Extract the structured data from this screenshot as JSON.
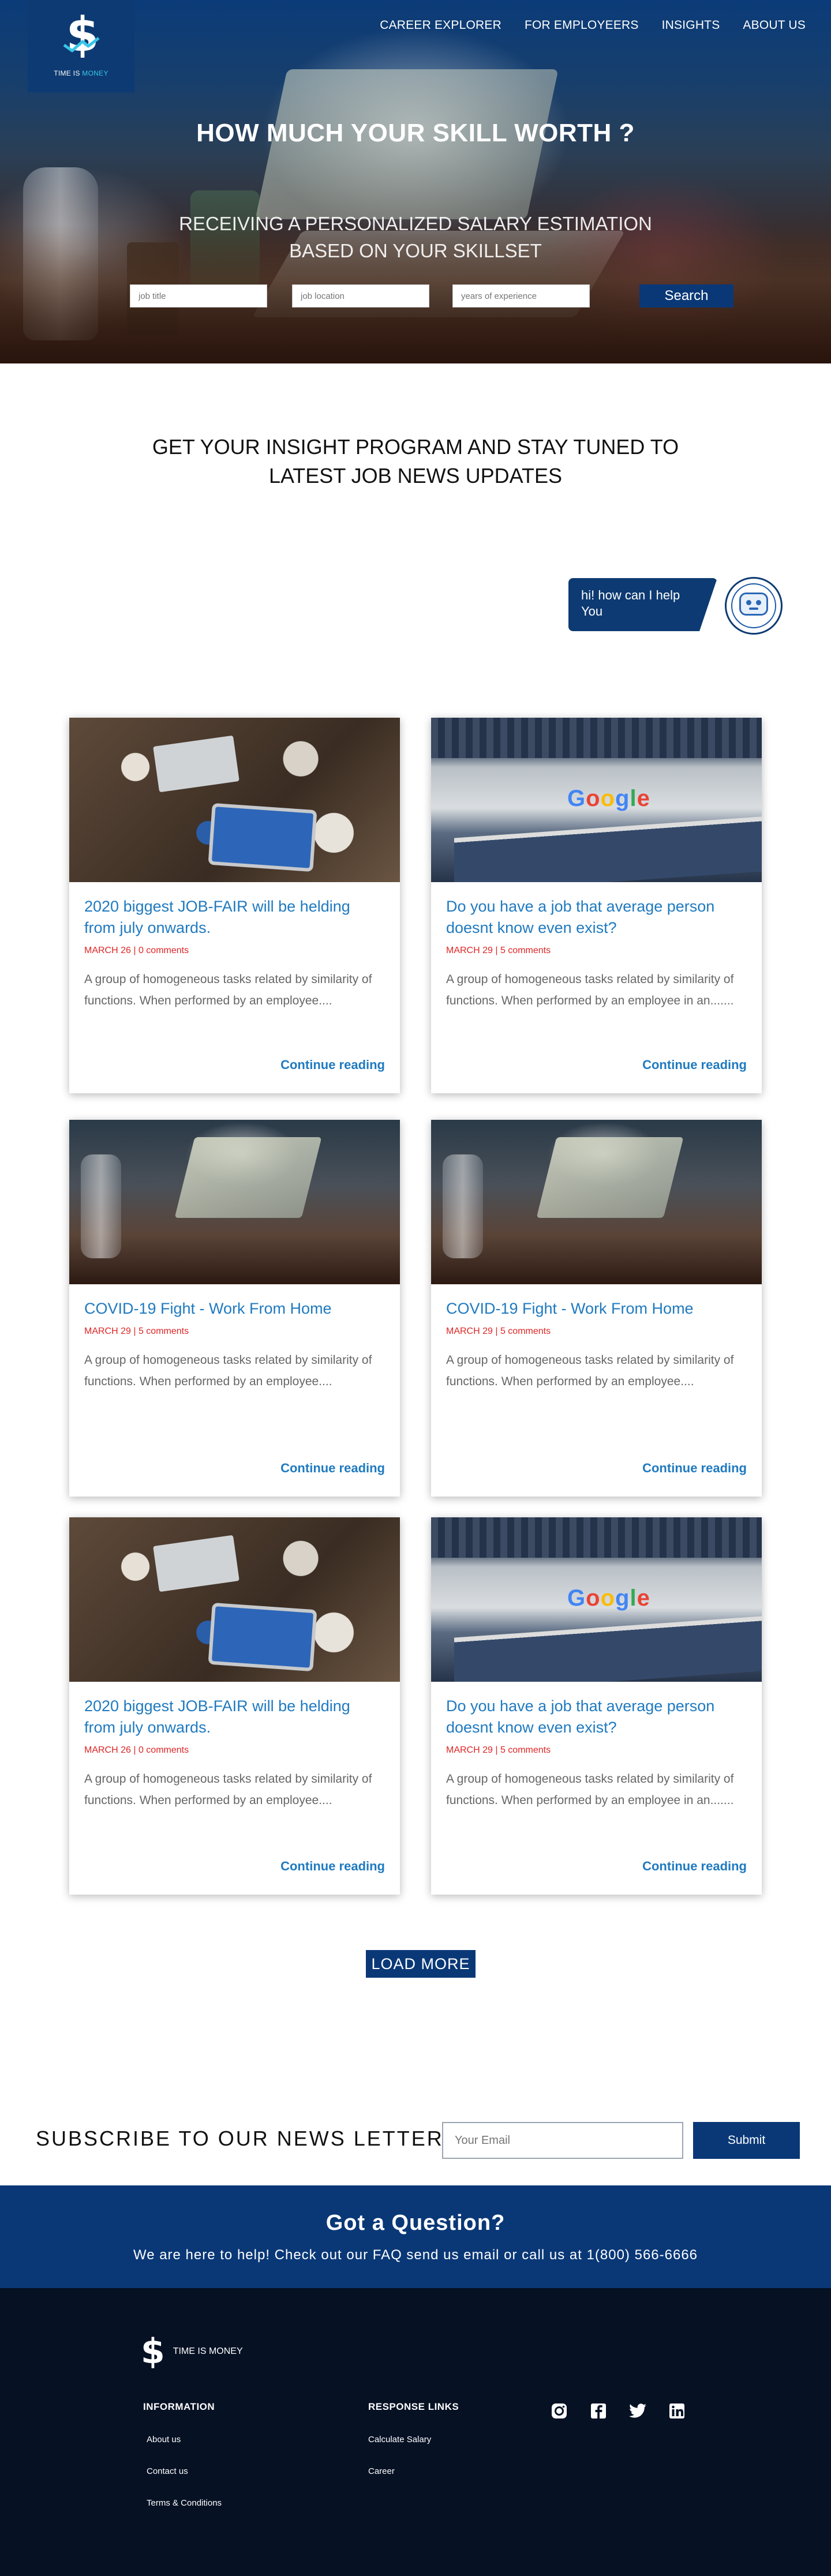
{
  "brand": {
    "name_left": "TIME IS ",
    "name_accent": "MONEY",
    "footer_name": "TIME IS MONEY",
    "accent_color": "#38c6e8",
    "primary_color": "#0a3877"
  },
  "nav": {
    "items": [
      "CAREER EXPLORER",
      "FOR EMPLOYEERS",
      "INSIGHTS",
      "ABOUT US"
    ]
  },
  "hero": {
    "title": "HOW MUCH YOUR SKILL WORTH ?",
    "subtitle_line1": "RECEIVING A PERSONALIZED SALARY ESTIMATION",
    "subtitle_line2": "BASED ON YOUR SKILLSET",
    "job_title_placeholder": "job title",
    "job_location_placeholder": "job location",
    "experience_placeholder": "years of experience",
    "search_label": "Search"
  },
  "insight": {
    "heading_line1": "GET YOUR INSIGHT PROGRAM AND STAY TUNED TO",
    "heading_line2": "LATEST JOB NEWS UPDATES"
  },
  "chat": {
    "message": "hi! how can I help You"
  },
  "cards": [
    {
      "image": "meeting-photo",
      "title": "2020 biggest JOB-FAIR will be helding from july onwards.",
      "meta": "MARCH 26 | 0 comments",
      "desc": "A group of homogeneous tasks related by similarity of functions. When performed by an employee....",
      "more": "Continue reading"
    },
    {
      "image": "google-office-photo",
      "title": "Do you have a job that average person doesnt know even exist?",
      "meta": "MARCH 29 | 5 comments",
      "desc": "A group of homogeneous tasks related by similarity of functions. When performed by an employee in an.......",
      "more": "Continue reading"
    },
    {
      "image": "laptop-work-photo",
      "title": "COVID-19 Fight - Work From Home",
      "meta": "MARCH 29 | 5 comments",
      "desc": "A group of homogeneous tasks related by similarity of functions. When performed by an employee....",
      "more": "Continue reading"
    },
    {
      "image": "laptop-work-photo",
      "title": "COVID-19 Fight - Work From Home",
      "meta": "MARCH 29 | 5 comments",
      "desc": "A group of homogeneous tasks related by similarity of functions. When performed by an employee....",
      "more": "Continue reading"
    },
    {
      "image": "meeting-photo",
      "title": "2020 biggest JOB-FAIR will be helding from july onwards.",
      "meta": "MARCH 26 | 0 comments",
      "desc": "A group of homogeneous tasks related by similarity of functions. When performed by an employee....",
      "more": "Continue reading"
    },
    {
      "image": "google-office-photo",
      "title": "Do you have a job that average person doesnt know even exist?",
      "meta": "MARCH 29 | 5 comments",
      "desc": "A group of homogeneous tasks related by similarity of functions. When performed by an employee in an.......",
      "more": "Continue reading"
    }
  ],
  "load_more": "LOAD MORE",
  "subscribe": {
    "label": "SUBSCRIBE TO OUR NEWS LETTER",
    "placeholder": "Your Email",
    "button": "Submit"
  },
  "question": {
    "title": "Got a Question?",
    "text": "We are here to help! Check out our FAQ send us email or call us at 1(800) 566-6666"
  },
  "footer": {
    "information": {
      "heading": "INFORMATION",
      "links": [
        "About us",
        "Contact us",
        "Terms & Conditions"
      ]
    },
    "response": {
      "heading": "RESPONSE LINKS",
      "links": [
        "Calculate Salary",
        "Career"
      ]
    },
    "socials": [
      "instagram-icon",
      "facebook-icon",
      "twitter-icon",
      "linkedin-icon"
    ]
  }
}
